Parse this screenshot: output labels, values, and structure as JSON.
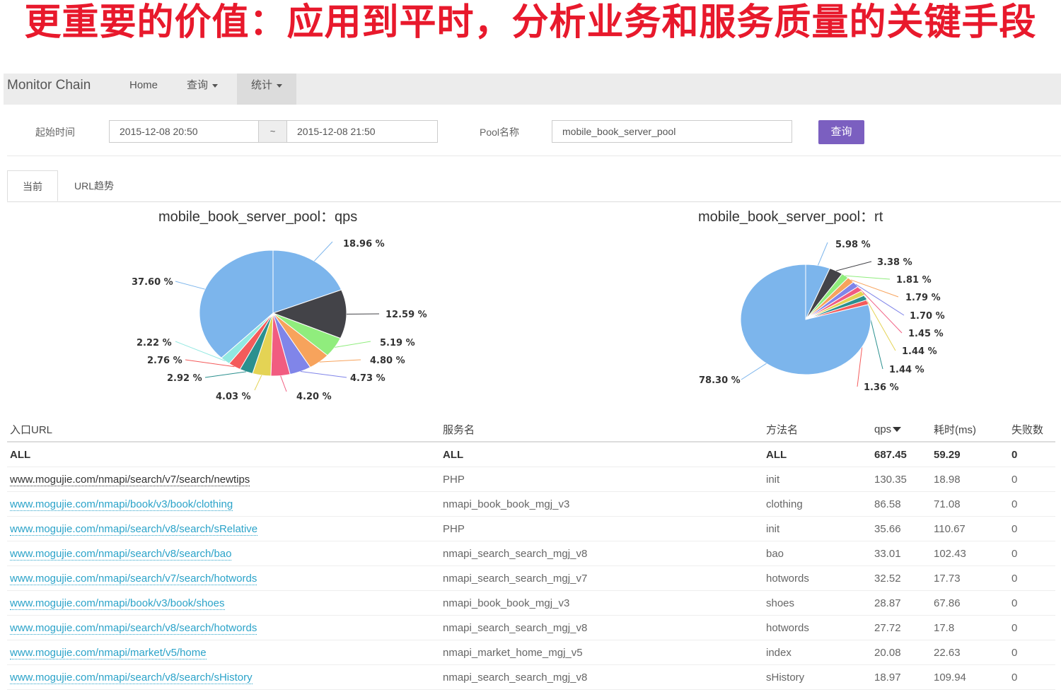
{
  "slide_title": "更重要的价值：应用到平时，分析业务和服务质量的关键手段",
  "navbar": {
    "brand": "Monitor Chain",
    "items": [
      {
        "label": "Home",
        "dropdown": false
      },
      {
        "label": "查询",
        "dropdown": true
      },
      {
        "label": "统计",
        "dropdown": true,
        "active": true
      }
    ]
  },
  "filter": {
    "start_label": "起始时间",
    "start_value": "2015-12-08 20:50",
    "separator": "~",
    "end_value": "2015-12-08 21:50",
    "pool_label": "Pool名称",
    "pool_value": "mobile_book_server_pool",
    "query_button": "查询"
  },
  "tabs": [
    {
      "label": "当前",
      "active": true
    },
    {
      "label": "URL趋势",
      "active": false
    }
  ],
  "chart_data": [
    {
      "type": "pie",
      "title": "mobile_book_server_pool：qps",
      "values": [
        18.96,
        12.59,
        5.19,
        4.8,
        4.73,
        4.2,
        4.03,
        2.92,
        2.76,
        2.22,
        37.6
      ],
      "labels": [
        "18.96 %",
        "12.59 %",
        "5.19 %",
        "4.80 %",
        "4.73 %",
        "4.20 %",
        "4.03 %",
        "2.92 %",
        "2.76 %",
        "2.22 %",
        "37.60 %"
      ],
      "colors": [
        "#7cb5ec",
        "#434348",
        "#90ed7d",
        "#f7a35c",
        "#8085e9",
        "#f15c80",
        "#e4d354",
        "#2b908f",
        "#f45b5b",
        "#91e8e1",
        "#7cb5ec"
      ]
    },
    {
      "type": "pie",
      "title": "mobile_book_server_pool：rt",
      "values": [
        5.98,
        3.38,
        1.81,
        1.79,
        1.7,
        1.45,
        1.44,
        1.44,
        1.36,
        78.3
      ],
      "labels": [
        "5.98 %",
        "3.38 %",
        "1.81 %",
        "1.79 %",
        "1.70 %",
        "1.45 %",
        "1.44 %",
        "1.44 %",
        "1.36 %",
        "78.30 %"
      ],
      "colors": [
        "#7cb5ec",
        "#434348",
        "#90ed7d",
        "#f7a35c",
        "#8085e9",
        "#f15c80",
        "#e4d354",
        "#2b908f",
        "#f45b5b",
        "#7cb5ec"
      ]
    }
  ],
  "table": {
    "headers": [
      "入口URL",
      "服务名",
      "方法名",
      "qps",
      "耗时(ms)",
      "失败数"
    ],
    "rows": [
      {
        "url": "ALL",
        "service": "ALL",
        "method": "ALL",
        "qps": "687.45",
        "rt": "59.29",
        "fail": "0",
        "style": "all"
      },
      {
        "url": "www.mogujie.com/nmapi/search/v7/search/newtips",
        "service": "PHP",
        "method": "init",
        "qps": "130.35",
        "rt": "18.98",
        "fail": "0",
        "style": "plain"
      },
      {
        "url": "www.mogujie.com/nmapi/book/v3/book/clothing",
        "service": "nmapi_book_book_mgj_v3",
        "method": "clothing",
        "qps": "86.58",
        "rt": "71.08",
        "fail": "0",
        "style": "link"
      },
      {
        "url": "www.mogujie.com/nmapi/search/v8/search/sRelative",
        "service": "PHP",
        "method": "init",
        "qps": "35.66",
        "rt": "110.67",
        "fail": "0",
        "style": "link"
      },
      {
        "url": "www.mogujie.com/nmapi/search/v8/search/bao",
        "service": "nmapi_search_search_mgj_v8",
        "method": "bao",
        "qps": "33.01",
        "rt": "102.43",
        "fail": "0",
        "style": "link"
      },
      {
        "url": "www.mogujie.com/nmapi/search/v7/search/hotwords",
        "service": "nmapi_search_search_mgj_v7",
        "method": "hotwords",
        "qps": "32.52",
        "rt": "17.73",
        "fail": "0",
        "style": "link"
      },
      {
        "url": "www.mogujie.com/nmapi/book/v3/book/shoes",
        "service": "nmapi_book_book_mgj_v3",
        "method": "shoes",
        "qps": "28.87",
        "rt": "67.86",
        "fail": "0",
        "style": "link"
      },
      {
        "url": "www.mogujie.com/nmapi/search/v8/search/hotwords",
        "service": "nmapi_search_search_mgj_v8",
        "method": "hotwords",
        "qps": "27.72",
        "rt": "17.8",
        "fail": "0",
        "style": "link"
      },
      {
        "url": "www.mogujie.com/nmapi/market/v5/home",
        "service": "nmapi_market_home_mgj_v5",
        "method": "index",
        "qps": "20.08",
        "rt": "22.63",
        "fail": "0",
        "style": "link"
      },
      {
        "url": "www.mogujie.com/nmapi/search/v8/search/sHistory",
        "service": "nmapi_search_search_mgj_v8",
        "method": "sHistory",
        "qps": "18.97",
        "rt": "109.94",
        "fail": "0",
        "style": "link"
      }
    ]
  }
}
